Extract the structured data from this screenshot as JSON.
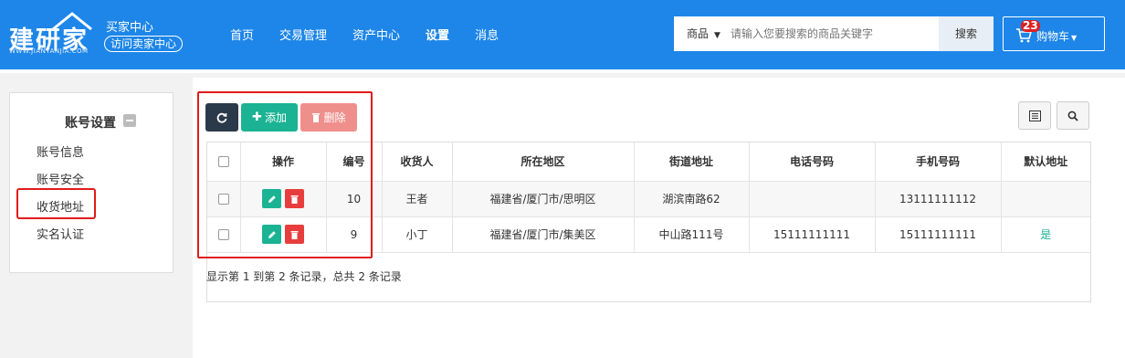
{
  "header": {
    "logo_text": "建研家",
    "logo_sub": "WWW.JIANYANJIA.COM",
    "buyer_center": "买家中心",
    "visit_seller": "访问卖家中心",
    "nav": [
      "首页",
      "交易管理",
      "资产中心",
      "设置",
      "消息"
    ],
    "active_nav": "设置",
    "search": {
      "category": "商品",
      "placeholder": "请输入您要搜索的商品关键字",
      "button": "搜索"
    },
    "cart": {
      "count": "23",
      "label": "购物车"
    },
    "colors": {
      "bar": "#1e86e8"
    }
  },
  "sidebar": {
    "title": "账号设置",
    "items": [
      "账号信息",
      "账号安全",
      "收货地址",
      "实名认证"
    ],
    "selected": "收货地址"
  },
  "toolbar": {
    "refresh_icon": "refresh-icon",
    "add_label": "添加",
    "delete_label": "删除",
    "columns_icon": "columns-icon",
    "search_icon": "search-icon"
  },
  "table": {
    "headers": [
      "操作",
      "编号",
      "收货人",
      "所在地区",
      "街道地址",
      "电话号码",
      "手机号码",
      "默认地址"
    ],
    "rows": [
      {
        "id": "10",
        "receiver": "王者",
        "region": "福建省/厦门市/思明区",
        "street": "湖滨南路62",
        "phone": "",
        "mobile": "13111111112",
        "default": ""
      },
      {
        "id": "9",
        "receiver": "小丁",
        "region": "福建省/厦门市/集美区",
        "street": "中山路111号",
        "phone": "15111111111",
        "mobile": "15111111111",
        "default": "是"
      }
    ]
  },
  "pagination": {
    "info": "显示第 1 到第 2 条记录，总共 2 条记录"
  }
}
